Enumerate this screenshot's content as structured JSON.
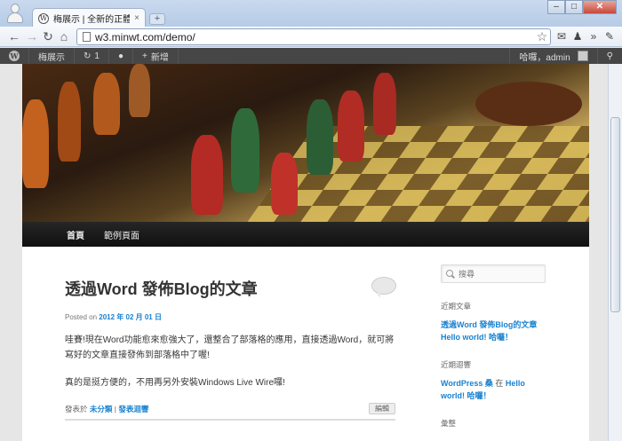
{
  "browser": {
    "tab_title": "梅展示 | 全新的正體中文 W",
    "tab_close": "×",
    "new_tab": "+",
    "url": "w3.minwt.com/demo/",
    "window_buttons": [
      "–",
      "□",
      "✕"
    ]
  },
  "adminbar": {
    "site_name": "梅展示",
    "updates_count": "1",
    "new_label": "新增",
    "greeting": "哈囉，admin"
  },
  "nav": {
    "home": "首頁",
    "sample_page": "範例頁面"
  },
  "post": {
    "title": "透過Word 發佈Blog的文章",
    "posted_on_label": "Posted on",
    "date": "2012 年 02 月 01 日",
    "paragraph1": "哇賽!現在Word功能愈來愈強大了，還整合了部落格的應用，直接透過Word，就可將寫好的文章直接發佈到部落格中了喔!",
    "paragraph2": "真的是挺方便的，不用再另外安裝Windows Live Wire囉!",
    "footer_prefix": "發表於",
    "category": "未分類",
    "separator": "|",
    "comment_link": "發表迴響",
    "edit_label": "編輯"
  },
  "sidebar": {
    "search_placeholder": "搜尋",
    "recent_posts_title": "近期文章",
    "recent_posts": [
      "透過Word 發佈Blog的文章",
      "Hello world! 哈囉！"
    ],
    "recent_comments_title": "近期迴響",
    "recent_comment_author": "WordPress 桑",
    "recent_comment_on": "在",
    "recent_comment_post": "Hello world! 哈囉！",
    "archives_title": "彙整"
  }
}
